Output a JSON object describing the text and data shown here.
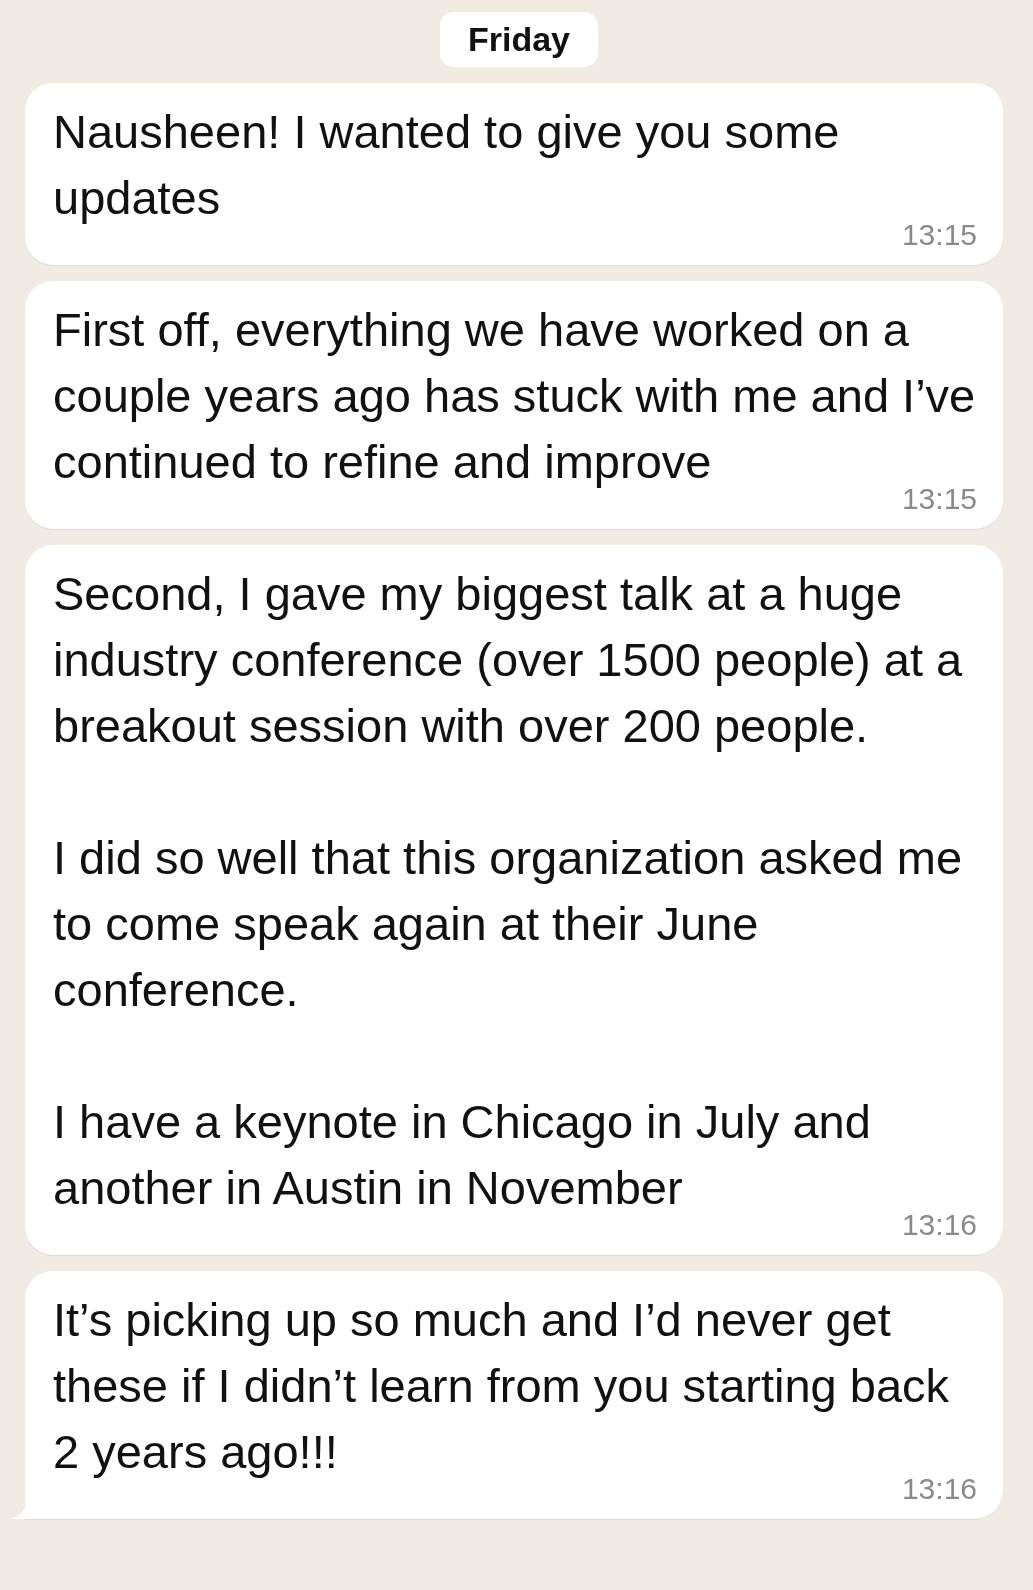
{
  "date_divider": "Friday",
  "messages": [
    {
      "text": "Nausheen! I wanted to give you some updates",
      "time": "13:15",
      "tail": false
    },
    {
      "text": "First off, everything we have worked on a couple years ago has stuck with me and I’ve continued to refine and improve",
      "time": "13:15",
      "tail": false
    },
    {
      "text": "Second, I gave my biggest talk at a huge industry conference (over 1500 people) at a breakout session with over 200 people.\n\nI did so well that this organization asked me to come speak again at their June conference.\n\nI have a keynote in Chicago in July and another in Austin in November",
      "time": "13:16",
      "tail": false
    },
    {
      "text": "It’s picking up so much and I’d never get these if I didn’t learn from you starting back 2 years ago!!!",
      "time": "13:16",
      "tail": true
    }
  ]
}
